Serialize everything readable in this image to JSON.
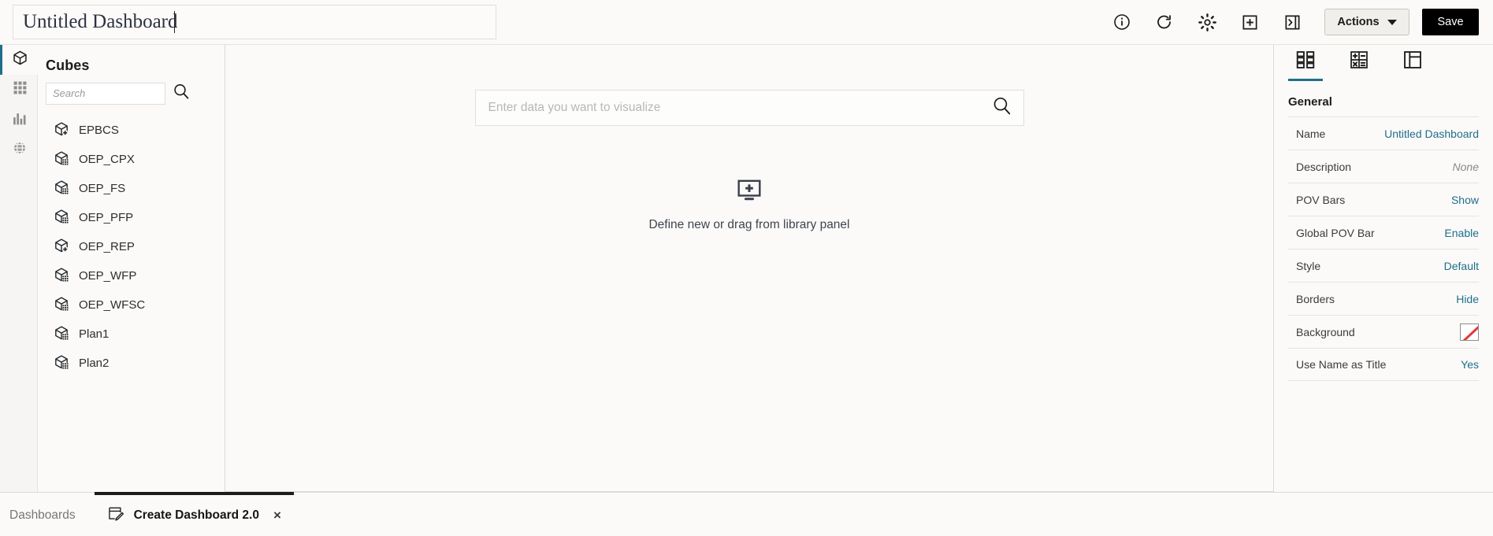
{
  "topbar": {
    "title_value": "Untitled Dashboard",
    "icons": [
      {
        "name": "info-icon",
        "label": "Information"
      },
      {
        "name": "refresh-icon",
        "label": "Refresh"
      },
      {
        "name": "gear-icon",
        "label": "Settings"
      },
      {
        "name": "add-box-icon",
        "label": "Add"
      },
      {
        "name": "collapse-panel-icon",
        "label": "Collapse Panel"
      }
    ],
    "actions_label": "Actions",
    "save_label": "Save"
  },
  "rail": {
    "items": [
      {
        "name": "rail-item-cubes",
        "icon": "cube-icon",
        "label": "Cubes",
        "active": true
      },
      {
        "name": "rail-item-forms",
        "icon": "grid-icon",
        "label": "Forms",
        "active": false
      },
      {
        "name": "rail-item-charts",
        "icon": "bar-chart-icon",
        "label": "Charts",
        "active": false
      },
      {
        "name": "rail-item-external",
        "icon": "globe-icon",
        "label": "External",
        "active": false
      }
    ]
  },
  "library": {
    "title": "Cubes",
    "search_placeholder": "Search",
    "search_value": "",
    "cubes": [
      {
        "label": "EPBCS",
        "badge": "plus"
      },
      {
        "label": "OEP_CPX",
        "badge": "grid"
      },
      {
        "label": "OEP_FS",
        "badge": "grid"
      },
      {
        "label": "OEP_PFP",
        "badge": "grid"
      },
      {
        "label": "OEP_REP",
        "badge": "plus"
      },
      {
        "label": "OEP_WFP",
        "badge": "grid"
      },
      {
        "label": "OEP_WFSC",
        "badge": "grid"
      },
      {
        "label": "Plan1",
        "badge": "grid"
      },
      {
        "label": "Plan2",
        "badge": "grid"
      }
    ]
  },
  "canvas": {
    "search_placeholder": "Enter data you want to visualize",
    "search_value": "",
    "dropzone_label": "Define new or drag from library panel"
  },
  "properties": {
    "tabs": [
      {
        "name": "tab-properties",
        "icon": "grid-tiles-icon",
        "active": true
      },
      {
        "name": "tab-calculations",
        "icon": "calculator-icon",
        "active": false
      },
      {
        "name": "tab-layout",
        "icon": "layout-icon",
        "active": false
      }
    ],
    "section_title": "General",
    "rows": [
      {
        "label": "Name",
        "value": "Untitled Dashboard",
        "kind": "link"
      },
      {
        "label": "Description",
        "value": "None",
        "kind": "muted"
      },
      {
        "label": "POV Bars",
        "value": "Show",
        "kind": "link"
      },
      {
        "label": "Global POV Bar",
        "value": "Enable",
        "kind": "link"
      },
      {
        "label": "Style",
        "value": "Default",
        "kind": "link"
      },
      {
        "label": "Borders",
        "value": "Hide",
        "kind": "link"
      },
      {
        "label": "Background",
        "value": "",
        "kind": "swatch"
      },
      {
        "label": "Use Name as Title",
        "value": "Yes",
        "kind": "link"
      }
    ]
  },
  "tabbar": {
    "tabs": [
      {
        "label": "Dashboards",
        "active": false,
        "closable": false,
        "icon": null
      },
      {
        "label": "Create Dashboard 2.0",
        "active": true,
        "closable": true,
        "icon": "dashboard-edit-icon",
        "close_glyph": "×"
      }
    ]
  },
  "colors": {
    "accent": "#1f6f8b",
    "link": "#1f6f8b",
    "save_bg": "#000000",
    "swatch_slash": "#e03a3a",
    "page_bg": "#fbfaf8"
  }
}
